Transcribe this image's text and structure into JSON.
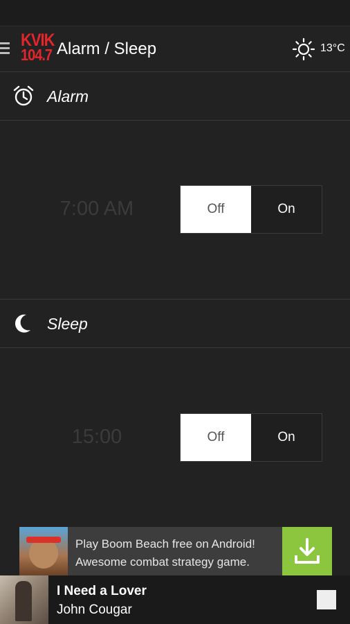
{
  "app_bar": {
    "title": "Alarm / Sleep",
    "logo_line1": "KVIK",
    "logo_line2": "104.7",
    "temperature": "13°C",
    "weather_icon": "sun-icon"
  },
  "alarm": {
    "label": "Alarm",
    "icon": "alarm-clock-icon",
    "time": "7:00 AM",
    "toggle": {
      "off_label": "Off",
      "on_label": "On",
      "selected": "Off"
    }
  },
  "sleep": {
    "label": "Sleep",
    "icon": "moon-icon",
    "time": "15:00",
    "toggle": {
      "off_label": "Off",
      "on_label": "On",
      "selected": "Off"
    }
  },
  "ad": {
    "line1": "Play Boom Beach free on Android!",
    "line2": "Awesome combat strategy game.",
    "action_icon": "download-icon"
  },
  "player": {
    "title": "I Need a Lover",
    "artist": "John Cougar",
    "control_icon": "stop-icon"
  },
  "colors": {
    "background": "#222222",
    "accent_ad": "#8cc63f",
    "logo_red": "#e3262b",
    "toggle_selected": "#ffffff"
  }
}
